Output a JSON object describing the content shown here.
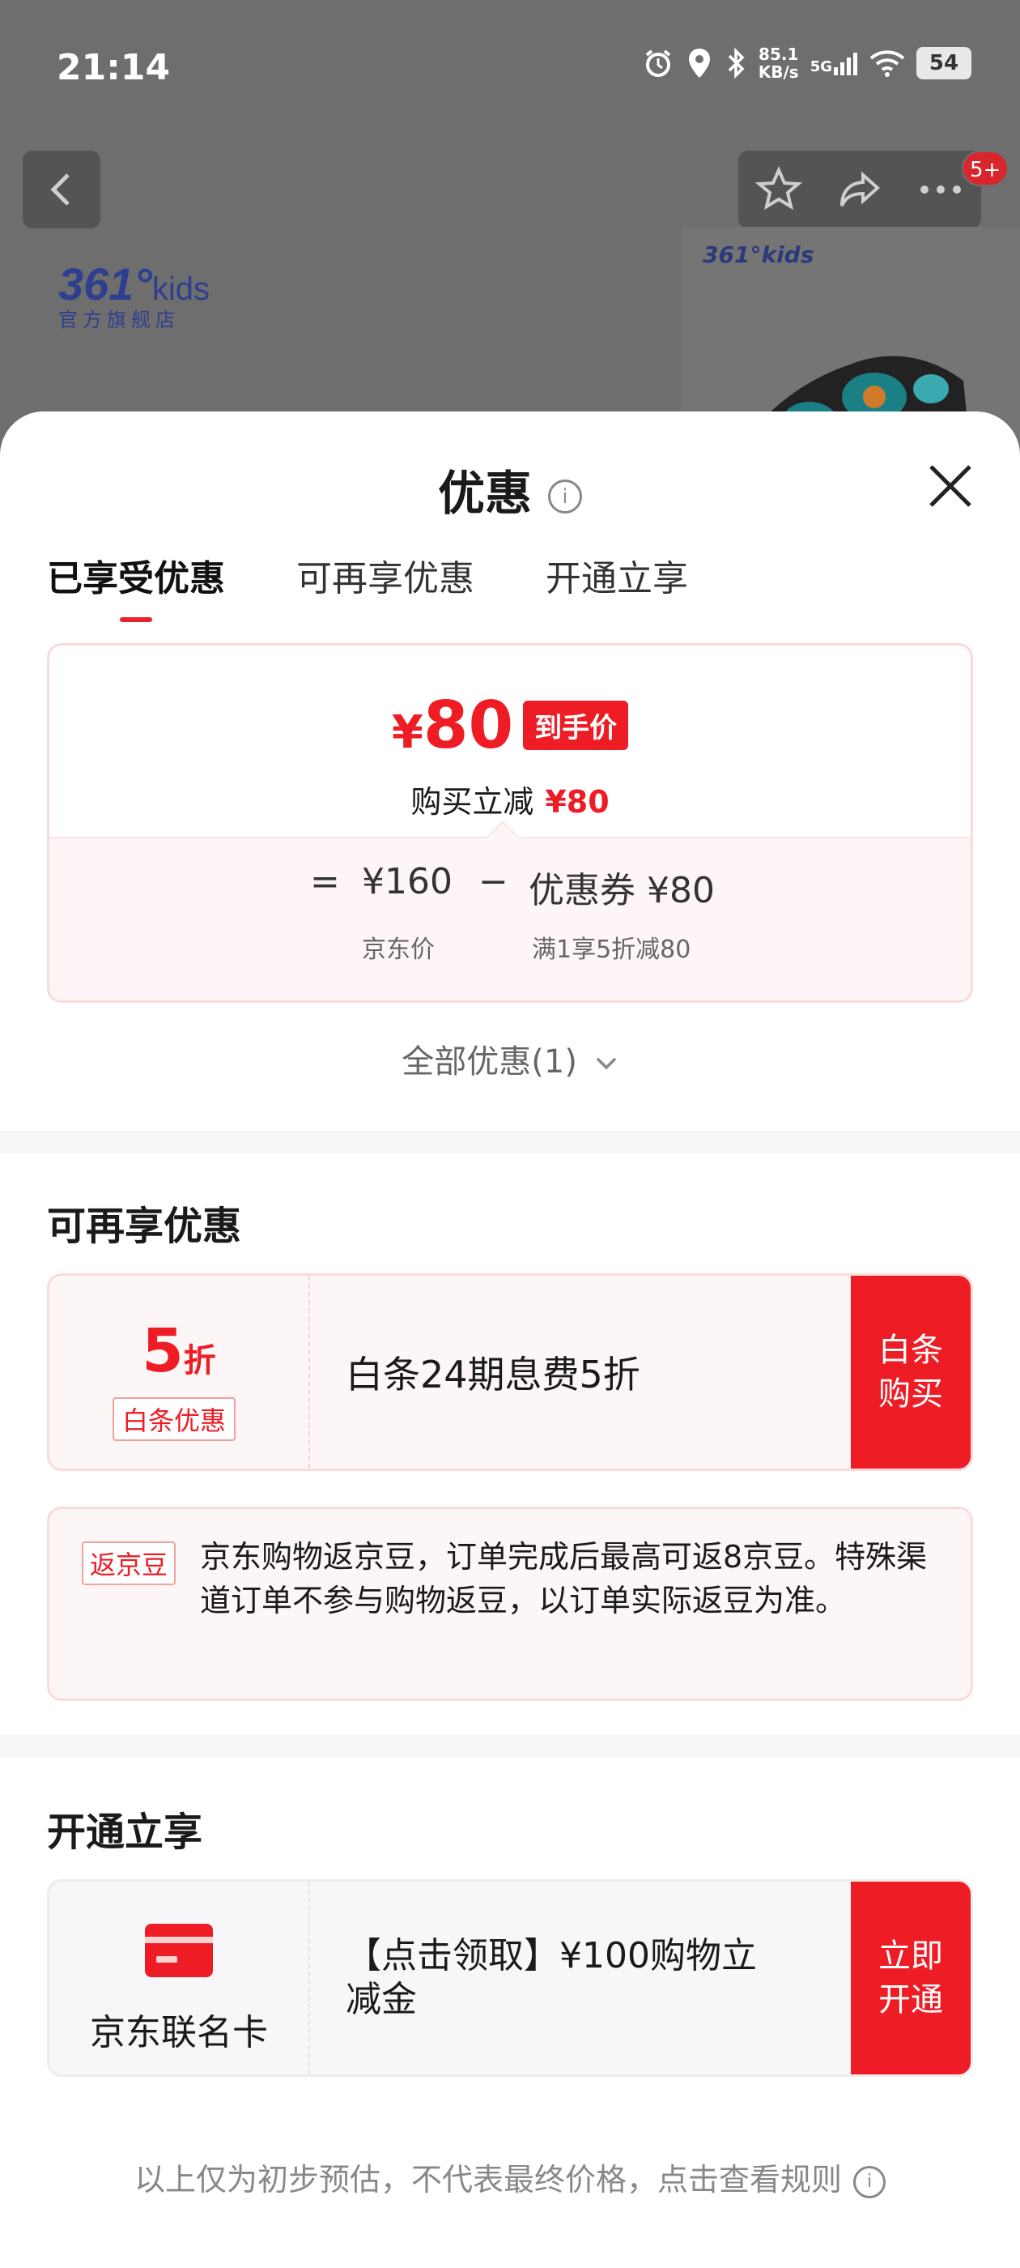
{
  "status": {
    "time": "21:14",
    "net_speed_top": "85.1",
    "net_speed_bottom": "KB/s",
    "network": "5G",
    "battery": "54"
  },
  "background": {
    "badge": "5+",
    "brand_number": "361°",
    "brand_kids": "kids",
    "brand_sub": "官方旗舰店",
    "product_logo": "361°kids"
  },
  "sheet": {
    "title": "优惠",
    "tabs": [
      {
        "label": "已享受优惠"
      },
      {
        "label": "可再享优惠"
      },
      {
        "label": "开通立享"
      }
    ],
    "summary": {
      "currency": "¥",
      "final_price": "80",
      "final_tag": "到手价",
      "reduce_label": "购买立减",
      "reduce_amount": "¥80",
      "eq": "=",
      "jd_price": "¥160",
      "minus": "−",
      "coupon": "优惠券 ¥80",
      "jd_price_label": "京东价",
      "coupon_rule": "满1享5折减80"
    },
    "all_discounts": "全部优惠(1)",
    "more_section": {
      "title": "可再享优惠",
      "baitiao": {
        "discount": "5",
        "unit": "折",
        "tag": "白条优惠",
        "desc": "白条24期息费5折",
        "btn_line1": "白条",
        "btn_line2": "购买"
      },
      "bean": {
        "tag": "返京豆",
        "text": "京东购物返京豆，订单完成后最高可返8京豆。特殊渠道订单不参与购物返豆，以订单实际返豆为准。"
      }
    },
    "open_section": {
      "title": "开通立享",
      "card_name": "京东联名卡",
      "desc": "【点击领取】¥100购物立减金",
      "btn_line1": "立即",
      "btn_line2": "开通"
    },
    "footer": "以上仅为初步预估，不代表最终价格，点击查看规则"
  }
}
